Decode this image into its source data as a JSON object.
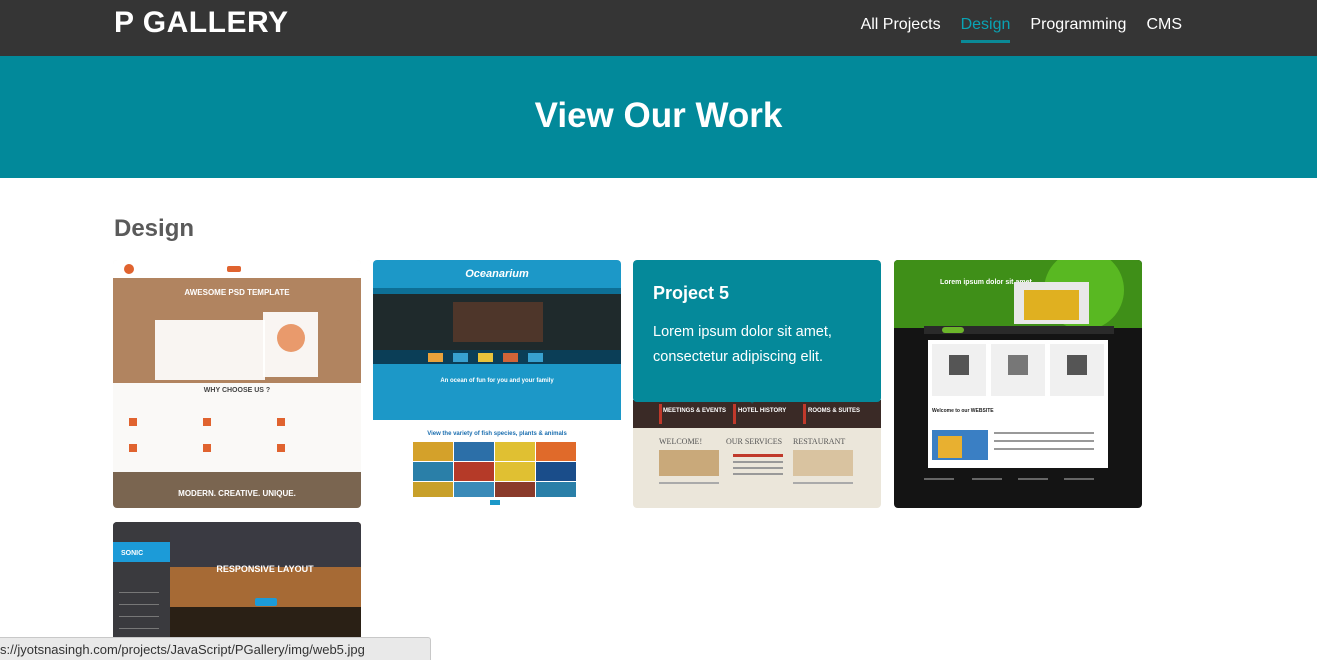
{
  "header": {
    "brand": "P GALLERY",
    "nav": [
      {
        "label": "All Projects",
        "active": false
      },
      {
        "label": "Design",
        "active": true
      },
      {
        "label": "Programming",
        "active": false
      },
      {
        "label": "CMS",
        "active": false
      }
    ]
  },
  "hero": {
    "title": "View Our Work"
  },
  "section": {
    "title": "Design"
  },
  "gallery": [
    {
      "image_text": [
        "AWESOME PSD TEMPLATE",
        "WHY CHOOSE US ?",
        "MODERN. CREATIVE. UNIQUE."
      ]
    },
    {
      "image_text": [
        "Oceanarium",
        "An ocean of fun for you and your family",
        "View the variety of fish species, plants & animals"
      ]
    },
    {
      "overlay_title": "Project 5",
      "overlay_text": "Lorem ipsum dolor sit amet, consectetur adipiscing elit.",
      "image_text": [
        "MEETINGS & EVENTS",
        "HOTEL HISTORY",
        "ROOMS & SUITES",
        "WELCOME!",
        "OUR SERVICES",
        "RESTAURANT"
      ]
    },
    {
      "image_text": [
        "Lorem ipsum dolor sit amet",
        "Welcome to our WEBSITE"
      ]
    },
    {
      "image_text": [
        "SONIC",
        "RESPONSIVE LAYOUT"
      ]
    }
  ],
  "status_url": "s://jyotsnasingh.com/projects/JavaScript/PGallery/img/web5.jpg",
  "colors": {
    "navbar": "#353535",
    "accent": "#02899a",
    "active_nav": "#0aa3b4"
  }
}
